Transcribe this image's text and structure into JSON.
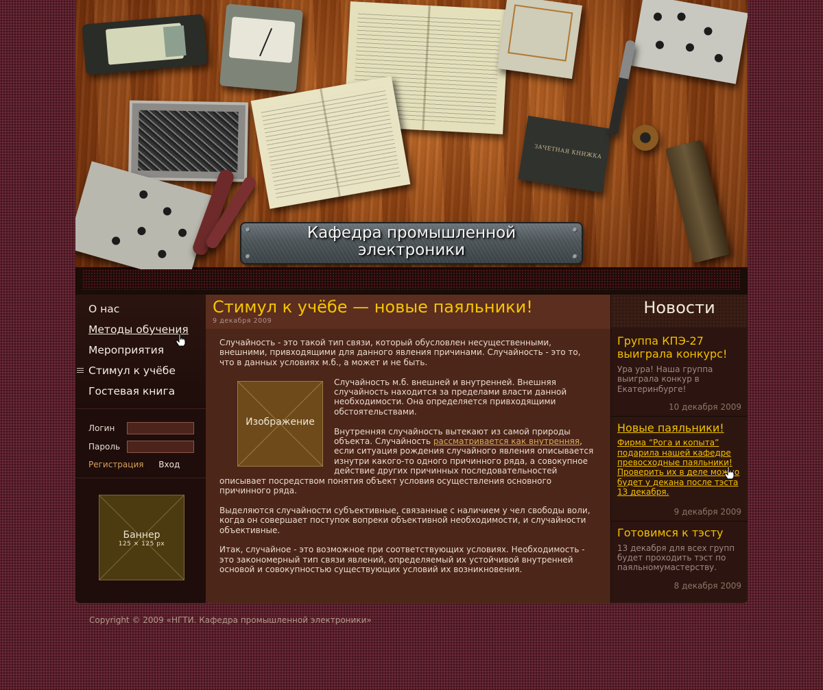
{
  "header": {
    "title_line1": "Кафедра промышленной",
    "title_line2": "электроники",
    "record_book_label": "ЗАЧЕТНАЯ КНИЖКА"
  },
  "menu": {
    "items": [
      {
        "label": "О нас"
      },
      {
        "label": "Методы обучения"
      },
      {
        "label": "Мероприятия"
      },
      {
        "label": "Стимул к учёбе"
      },
      {
        "label": "Гостевая книга"
      }
    ]
  },
  "login": {
    "login_label": "Логин",
    "password_label": "Пароль",
    "login_value": "",
    "password_value": "",
    "register_label": "Регистрация",
    "enter_label": "Вход"
  },
  "banner": {
    "label": "Баннер",
    "size": "125 × 125 px"
  },
  "article": {
    "title": "Стимул к учёбе — новые паяльники!",
    "date": "9 декабря 2009",
    "p1": "Случайность - это такой тип связи, который обусловлен несущественными, внешними, привходящими для данного явления причинами. Случайность - это то, что в данных условиях м.б., а может и не быть.",
    "image_label": "Изображение",
    "p2": "Случайность м.б. внешней и внутренней. Внешняя случайность находится за пределами власти данной необходимости. Она определяется привходящими обстоятельствами.",
    "p3_before": "Внутренняя случайность вытекают из самой природы объекта. Случайность ",
    "p3_link": "рассматривается как внутренняя",
    "p3_after": ", если  ситуация рождения случайного явления описывается изнутри какого-то одного причинного ряда, а совокупное действие других причинных последовательностей описывает посредством понятия объект условия осуществления основного причинного ряда.",
    "p4": "Выделяются случайности субъективные, связанные с наличием у чел свободы воли, когда он совершает поступок вопреки объективной необходимости, и случайности объективные.",
    "p5": "Итак, случайное - это возможное при соответствующих условиях. Необходимость - это закономерный тип связи явлений, определяемый их устойчивой внутренней основой и совокупностью существующих условий их возникновения."
  },
  "news": {
    "title": "Новости",
    "items": [
      {
        "title": "Группа КПЭ-27 выиграла конкурс!",
        "body": "Ура ура! Наша группа выиграла конкур в Екатеринбурге!",
        "date": "10 декабря 2009"
      },
      {
        "title": "Новые паяльники!",
        "body": "Фирма “Рога и копыта” подарила нашей кафедре превосходные паяльники! Проверить их в деле можно будет у декана после тэста 13 декабря.",
        "date": "9 декабря 2009"
      },
      {
        "title": "Готовимся к тэсту",
        "body": "13 декабря для всех групп будет проходить тэст по паяльномумастерству.",
        "date": "8 декабря 2009"
      }
    ]
  },
  "footer": {
    "copyright": "Copyright © 2009 «НГТИ. Кафедра промышленной электроники»"
  }
}
